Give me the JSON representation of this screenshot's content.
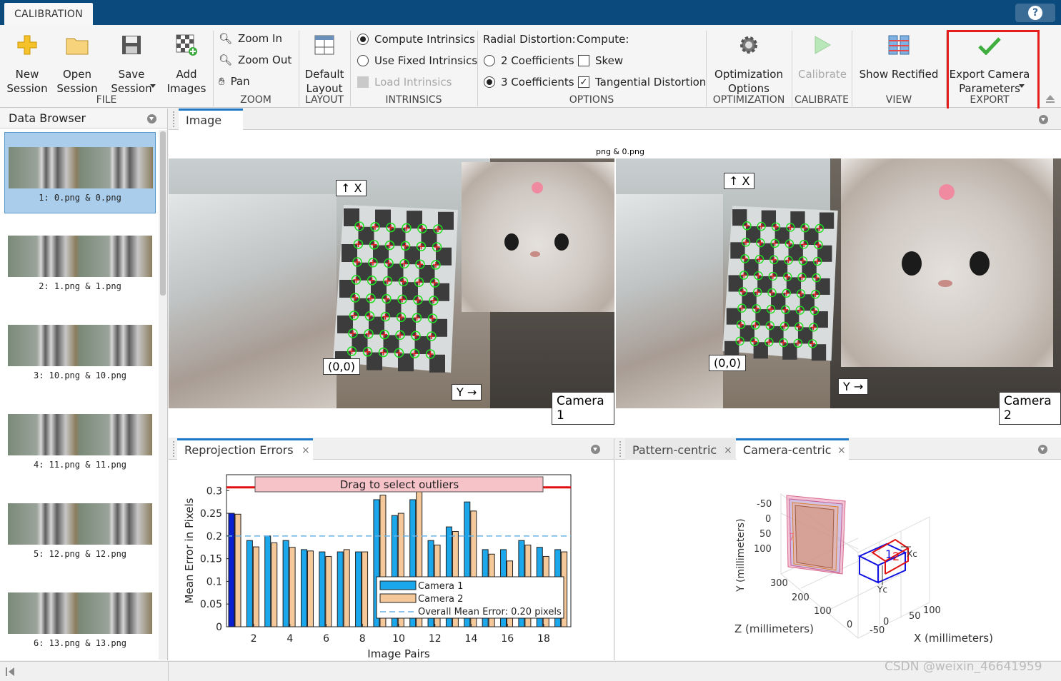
{
  "app_tab": "CALIBRATION",
  "help_label": "?",
  "toolstrip": {
    "file": {
      "group_label": "FILE",
      "new": "New\nSession",
      "open": "Open\nSession",
      "save": "Save\nSession",
      "add": "Add\nImages"
    },
    "zoom": {
      "group_label": "ZOOM",
      "zoom_in": "Zoom In",
      "zoom_out": "Zoom Out",
      "pan": "Pan"
    },
    "layout": {
      "group_label": "LAYOUT",
      "default": "Default\nLayout"
    },
    "intrinsics": {
      "group_label": "INTRINSICS",
      "compute": "Compute Intrinsics",
      "fixed": "Use Fixed Intrinsics",
      "load": "Load Intrinsics"
    },
    "options": {
      "group_label": "OPTIONS",
      "radial": "Radial Distortion:",
      "compute": "Compute:",
      "two": "2 Coefficients",
      "three": "3 Coefficients",
      "skew": "Skew",
      "tangential": "Tangential Distortion"
    },
    "optimization": {
      "group_label": "OPTIMIZATION",
      "label": "Optimization\nOptions"
    },
    "calibrate": {
      "group_label": "CALIBRATE",
      "label": "Calibrate"
    },
    "view": {
      "group_label": "VIEW",
      "label": "Show Rectified"
    },
    "export": {
      "group_label": "EXPORT",
      "label": "Export Camera\nParameters"
    }
  },
  "data_browser": {
    "title": "Data Browser",
    "items": [
      {
        "label": "1: 0.png & 0.png",
        "selected": true
      },
      {
        "label": "2: 1.png & 1.png"
      },
      {
        "label": "3: 10.png & 10.png"
      },
      {
        "label": "4: 11.png & 11.png"
      },
      {
        "label": "5: 12.png & 12.png"
      },
      {
        "label": "6: 13.png & 13.png"
      }
    ]
  },
  "image_panel": {
    "tab": "Image",
    "file_title": "png & 0.png",
    "cam1": "Camera 1",
    "cam2": "Camera 2",
    "x_tag": "↑ X",
    "y_tag": "Y →",
    "origin_tag": "(0,0)"
  },
  "reprojection": {
    "tab": "Reprojection Errors",
    "close": "×",
    "drag_label": "Drag to select outliers",
    "legend": [
      "Camera 1",
      "Camera 2",
      "Overall Mean Error: 0.20 pixels"
    ]
  },
  "pattern_tabs": {
    "pattern": "Pattern-centric",
    "camera": "Camera-centric",
    "close": "×"
  },
  "extrinsics": {
    "ylabel": "Y (millimeters)",
    "zlabel": "Z (millimeters)",
    "xlabel": "X (millimeters)",
    "yticks": [
      "-50",
      "0",
      "50",
      "100"
    ],
    "zticks": [
      "300",
      "200",
      "100",
      "0"
    ],
    "xticks": [
      "-50",
      "0",
      "50",
      "100"
    ],
    "xc": "Xc",
    "yc": "Yc",
    "cam_labels": [
      "1",
      "2"
    ]
  },
  "watermark": "CSDN @weixin_46641959",
  "colors": {
    "titlebar": "#0b4a7d",
    "accent": "#1b78c8",
    "cam1": "#1aa7ec",
    "cam2": "#f5c89a",
    "highlight": "#e51c1c"
  },
  "chart_data": {
    "type": "bar",
    "xlabel": "Image Pairs",
    "ylabel": "Mean Error in Pixels",
    "xticks": [
      "2",
      "4",
      "6",
      "8",
      "10",
      "12",
      "14",
      "16",
      "18"
    ],
    "yticks": [
      "0",
      "0.05",
      "0.1",
      "0.15",
      "0.2",
      "0.25",
      "0.3"
    ],
    "ylim": [
      0,
      0.335
    ],
    "categories": [
      1,
      2,
      3,
      4,
      5,
      6,
      7,
      8,
      9,
      10,
      11,
      12,
      13,
      14,
      15,
      16,
      17,
      18,
      19
    ],
    "series": [
      {
        "name": "Camera 1",
        "values": [
          0.25,
          0.19,
          0.2,
          0.19,
          0.17,
          0.165,
          0.165,
          0.165,
          0.28,
          0.245,
          0.28,
          0.19,
          0.22,
          0.275,
          0.17,
          0.17,
          0.19,
          0.175,
          0.17
        ]
      },
      {
        "name": "Camera 2",
        "values": [
          0.248,
          0.176,
          0.185,
          0.175,
          0.167,
          0.155,
          0.17,
          0.165,
          0.29,
          0.25,
          0.31,
          0.18,
          0.21,
          0.255,
          0.16,
          0.145,
          0.18,
          0.155,
          0.165
        ]
      }
    ],
    "mean_error": 0.2,
    "outlier_threshold": 0.307,
    "legend_position": "bottom-right"
  }
}
